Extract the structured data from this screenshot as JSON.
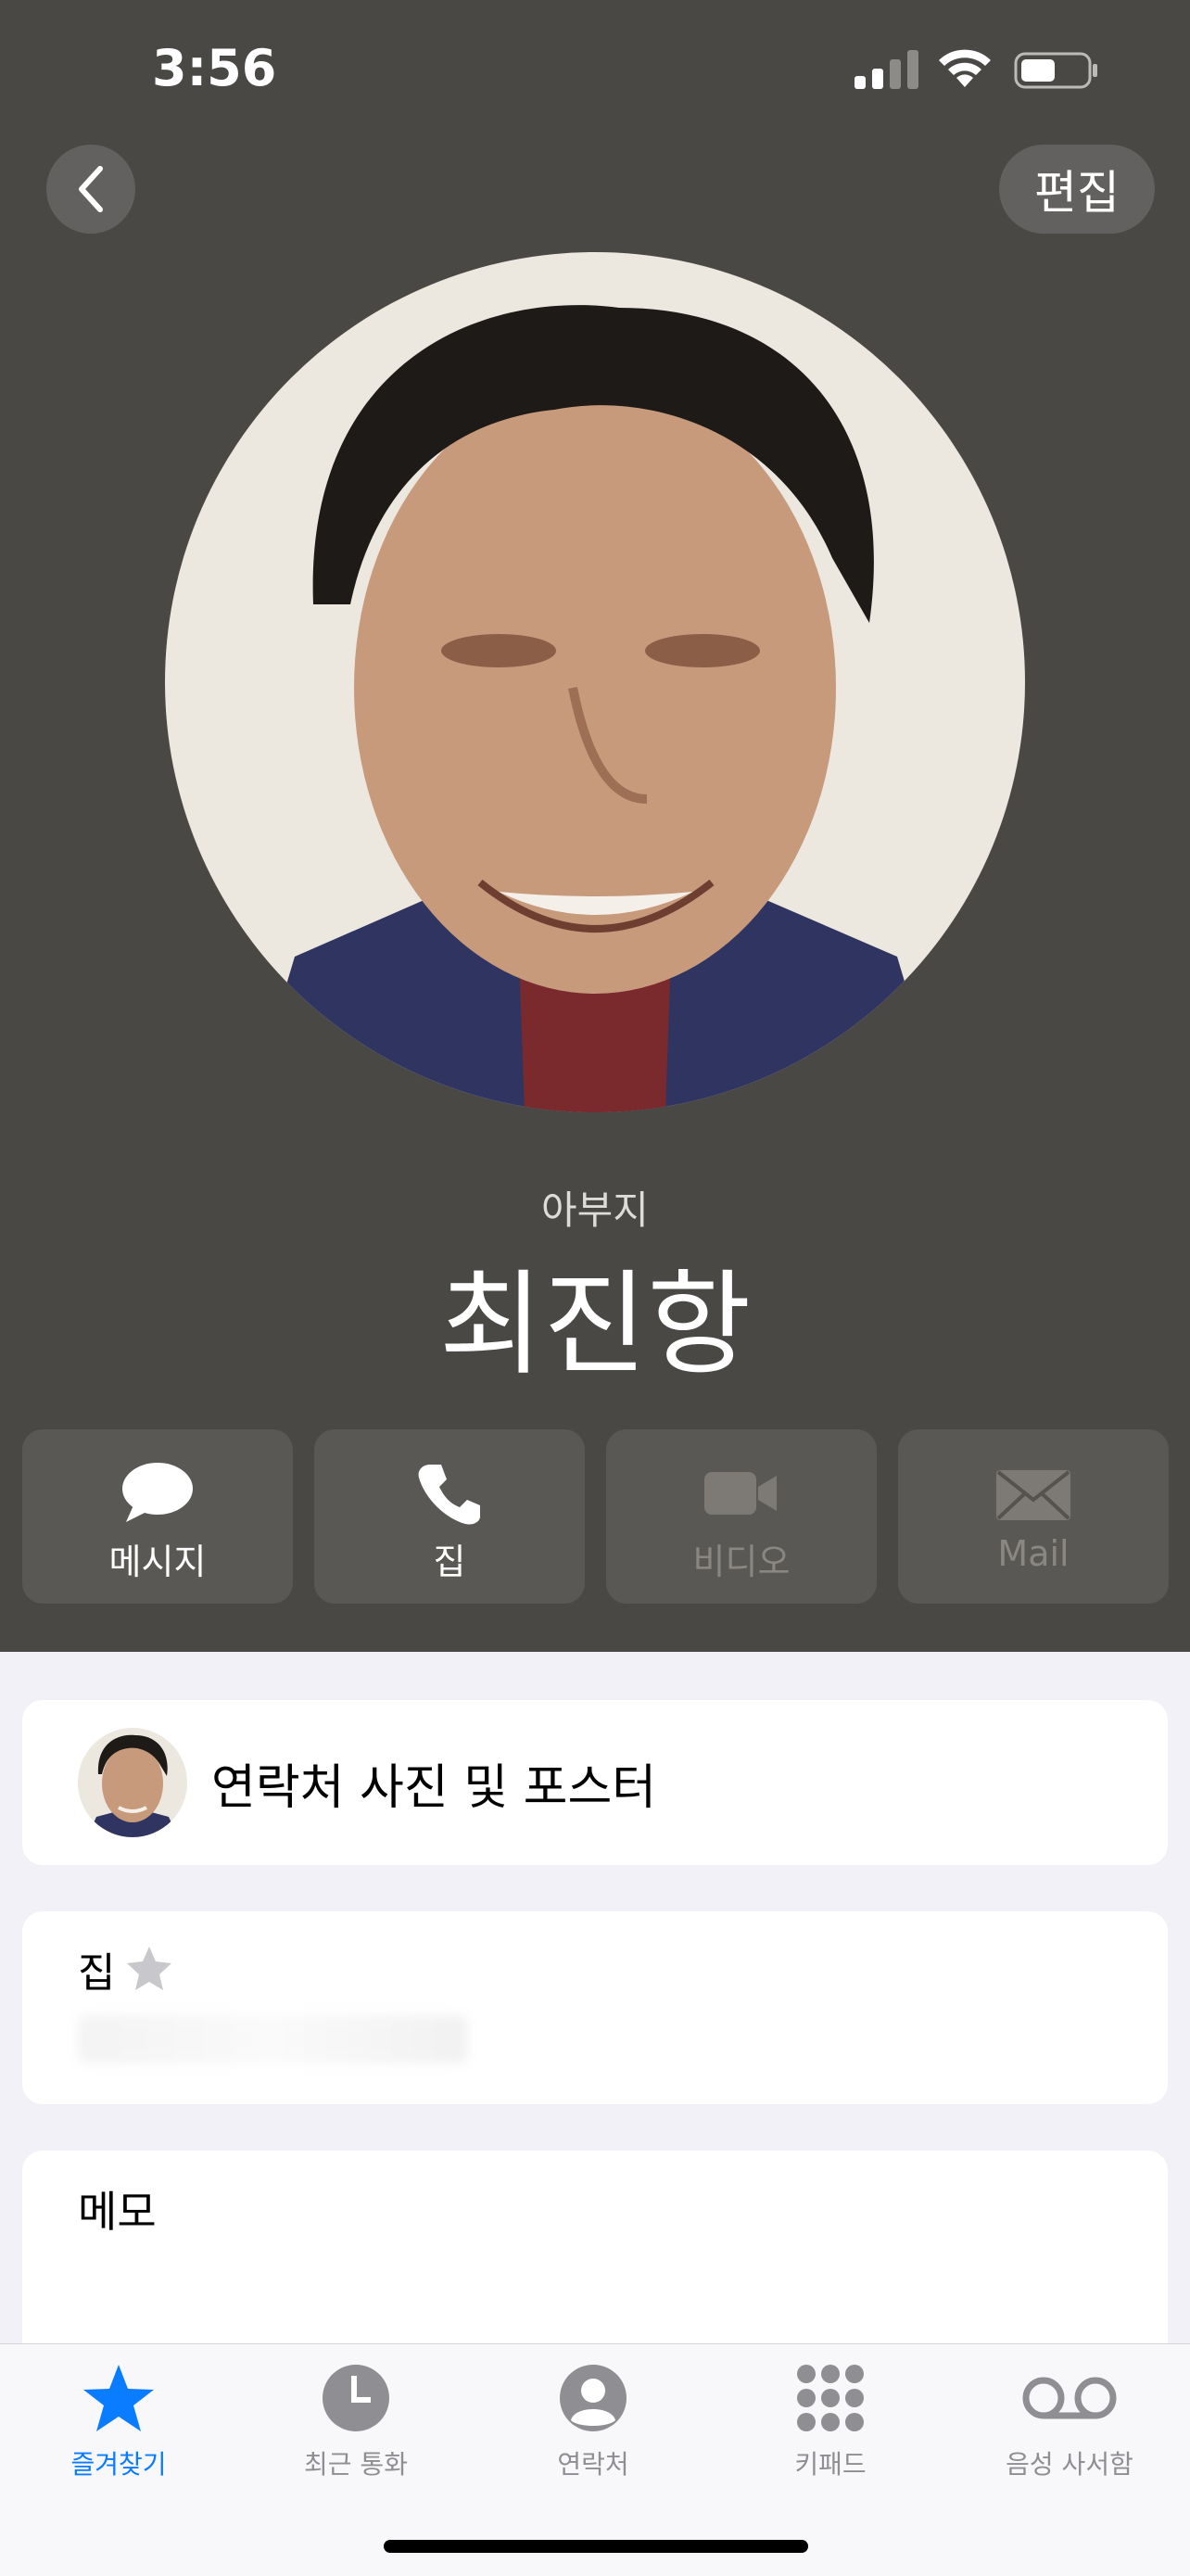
{
  "status_bar": {
    "time": "3:56"
  },
  "nav": {
    "edit_label": "편집"
  },
  "contact": {
    "relation": "아부지",
    "name": "최진항"
  },
  "actions": [
    {
      "label": "메시지",
      "icon": "message-icon",
      "enabled": true
    },
    {
      "label": "집",
      "icon": "phone-icon",
      "enabled": true
    },
    {
      "label": "비디오",
      "icon": "video-icon",
      "enabled": false
    },
    {
      "label": "Mail",
      "icon": "mail-icon",
      "enabled": false
    }
  ],
  "cards": {
    "photo_poster": "연락처 사진 및 포스터",
    "home_label": "집",
    "memo_label": "메모"
  },
  "tabs": [
    {
      "label": "즐겨찾기",
      "icon": "star-icon",
      "active": true
    },
    {
      "label": "최근 통화",
      "icon": "clock-icon",
      "active": false
    },
    {
      "label": "연락처",
      "icon": "person-icon",
      "active": false
    },
    {
      "label": "키패드",
      "icon": "keypad-icon",
      "active": false
    },
    {
      "label": "음성 사서함",
      "icon": "voicemail-icon",
      "active": false
    }
  ],
  "colors": {
    "header_bg": "#4a4845",
    "accent": "#0a7cff",
    "page_bg": "#f2f1f7"
  }
}
